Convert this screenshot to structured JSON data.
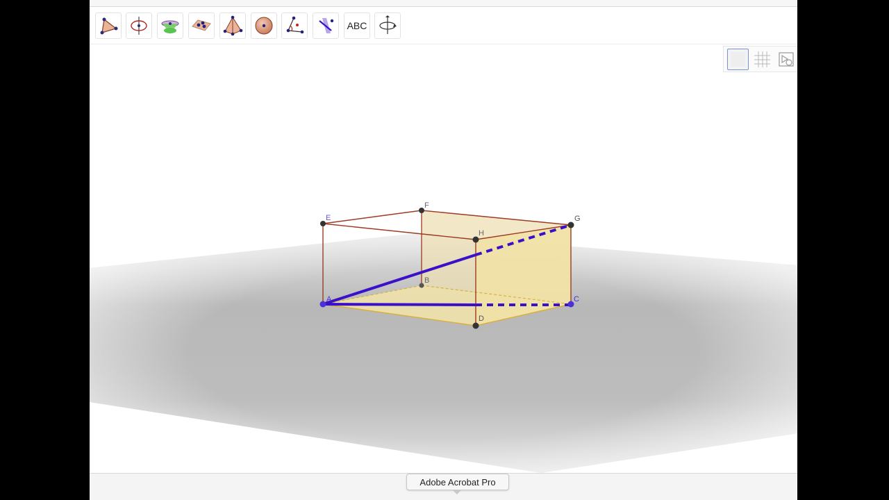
{
  "toolbar": {
    "tools": [
      {
        "name": "polygon-tool-icon"
      },
      {
        "name": "rotate-around-line-tool-icon"
      },
      {
        "name": "cone-tool-icon"
      },
      {
        "name": "plane-through-points-tool-icon"
      },
      {
        "name": "pyramid-tool-icon"
      },
      {
        "name": "sphere-tool-icon"
      },
      {
        "name": "angle-tool-icon"
      },
      {
        "name": "reflect-about-plane-tool-icon"
      },
      {
        "name": "text-tool",
        "label": "ABC"
      },
      {
        "name": "rotate-3d-view-tool-icon"
      }
    ]
  },
  "style_bar": {
    "buttons": [
      "show-axes-icon",
      "show-grid-icon",
      "view-in-front-of-icon"
    ]
  },
  "scene": {
    "points": {
      "A": "A",
      "B": "B",
      "C": "C",
      "D": "D",
      "E": "E",
      "F": "F",
      "G": "G",
      "H": "H"
    },
    "colors": {
      "edge": "#9c3a22",
      "face": "#f1e2a7",
      "diagonal": "#3a10c8",
      "plane": "#bdbdbd",
      "point_blue": "#4a30d6",
      "point_dark": "#333333"
    }
  },
  "tooltip": {
    "text": "Adobe Acrobat Pro"
  }
}
